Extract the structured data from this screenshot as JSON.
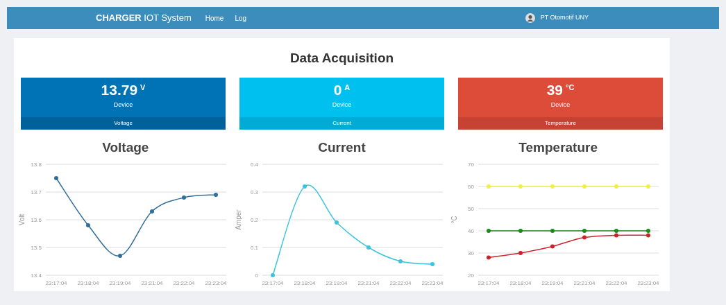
{
  "navbar": {
    "brand": "**CHARGER** IOT System",
    "links": [
      "Home",
      "Log"
    ],
    "user": "PT Otomotif UNY"
  },
  "page": {
    "title": "Data Acquisition"
  },
  "cards": [
    {
      "kind": "voltage",
      "value": "13.79",
      "unit": "V",
      "label": "Device",
      "footer": "Voltage",
      "color": "#0073b7"
    },
    {
      "kind": "current",
      "value": "0",
      "unit": "A",
      "label": "Device",
      "footer": "Current",
      "color": "#00c0ef"
    },
    {
      "kind": "temperature",
      "value": "39",
      "unit": "°C",
      "label": "Device",
      "footer": "Temperature",
      "color": "#dd4b39"
    }
  ],
  "charts": [
    {
      "chart_data": {
        "type": "line",
        "title": "Voltage",
        "ylabel": "Volt",
        "categories": [
          "23:17:04",
          "23:18:04",
          "23:19:04",
          "23:21:04",
          "23:22:04",
          "23:23:04"
        ],
        "ylim": [
          13.4,
          13.8
        ],
        "grid": true,
        "yticks": [
          13.4,
          13.5,
          13.6,
          13.7,
          13.8
        ],
        "series": [
          {
            "color": "#2f6f9a",
            "marker": true,
            "values": [
              13.75,
              13.58,
              13.47,
              13.63,
              13.68,
              13.69
            ]
          }
        ]
      }
    },
    {
      "chart_data": {
        "type": "line",
        "title": "Current",
        "ylabel": "Amper",
        "categories": [
          "23:17:04",
          "23:18:04",
          "23:19:04",
          "23:21:04",
          "23:22:04",
          "23:23:04"
        ],
        "ylim": [
          0,
          0.4
        ],
        "grid": true,
        "yticks": [
          0,
          0.1,
          0.2,
          0.3,
          0.4
        ],
        "series": [
          {
            "color": "#3cc4dc",
            "marker": true,
            "values": [
              0,
              0.32,
              0.19,
              0.1,
              0.05,
              0.04
            ]
          }
        ]
      }
    },
    {
      "chart_data": {
        "type": "line",
        "title": "Temperature",
        "ylabel": "°C",
        "categories": [
          "23:17:04",
          "23:18:04",
          "23:19:04",
          "23:21:04",
          "23:22:04",
          "23:23:04"
        ],
        "ylim": [
          20,
          70
        ],
        "grid": true,
        "yticks": [
          20,
          30,
          40,
          50,
          60,
          70
        ],
        "series": [
          {
            "color": "#f0f040",
            "marker": true,
            "values": [
              60,
              60,
              60,
              60,
              60,
              60
            ]
          },
          {
            "color": "#1a8a1a",
            "marker": true,
            "values": [
              40,
              40,
              40,
              40,
              40,
              40
            ]
          },
          {
            "color": "#d0202a",
            "marker": true,
            "values": [
              28,
              30,
              33,
              37,
              38,
              38
            ]
          }
        ]
      }
    }
  ]
}
